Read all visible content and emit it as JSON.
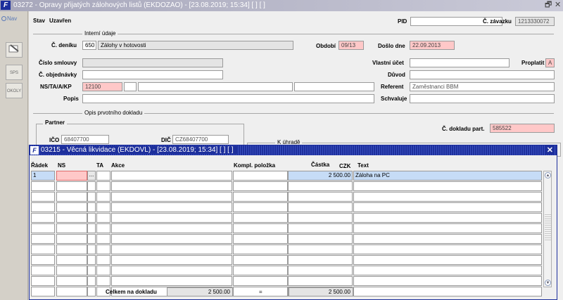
{
  "window": {
    "app_icon": "F",
    "title": "03272 - Opravy přijatých zálohových listů (EKDOZAO) - [23.08.2019; 15:34]  [ ]  [ ]",
    "restore_glyph": "ᵛ",
    "close_glyph": "✕"
  },
  "toolbar": {
    "nav_label": "Nav",
    "tools": [
      "edit-icon",
      "sps-icon",
      "okoly-icon"
    ],
    "sps_label": "SPS",
    "okoly_label": "OKOLY"
  },
  "form": {
    "stav_label": "Stav",
    "stav_value": "Uzavřen",
    "pid_label": "PID",
    "pid_value": "",
    "c_zavazku_label": "Č. závazku",
    "c_zavazku_value": "1213330072",
    "interni_udaje": "Interní údaje",
    "c_deniku_label": "Č. deníku",
    "c_deniku_value": "650",
    "denik_name": "Zálohy v hotovosti",
    "obdobi_label": "Období",
    "obdobi_value": "09/13",
    "doslo_dne_label": "Došlo dne",
    "doslo_dne_value": "22.09.2013",
    "cislo_smlouvy_label": "Číslo smlouvy",
    "vlastni_ucet_label": "Vlastní účet",
    "proplatit_label": "Proplatit",
    "proplatit_value": "A",
    "c_objednavky_label": "Č. objednávky",
    "duvod_label": "Důvod",
    "ns_label": "NS/TA/A/KP",
    "ns_value": "12100",
    "referent_label": "Referent",
    "referent_value": "Zaměstnanci BBM",
    "popis_label": "Popis",
    "schvaluje_label": "Schvaluje",
    "opis_label": "Opis prvotního dokladu",
    "partner_label": "Partner",
    "ico_label": "IČO",
    "ico_value": "68407700",
    "dic_label": "DIČ",
    "dic_value": "CZ68407700",
    "c_dokladu_part_label": "Č. dokladu part.",
    "c_dokladu_part_value": "585522",
    "k_uhrade_label": "K úhradě"
  },
  "dialog": {
    "app_icon": "F",
    "title": "03215 - Věcná likvidace (EKDOVL) - [23.08.2019; 15:34]  [ ]  [ ]",
    "close_glyph": "✕",
    "columns": {
      "radek": "Řádek",
      "ns": "NS",
      "ta": "TA",
      "akce": "Akce",
      "kompl": "Kompl. položka",
      "castka": "Částka",
      "czk": "CZK",
      "text": "Text"
    },
    "rows": [
      {
        "radek": "1",
        "ns": "",
        "ta": "",
        "akce": "",
        "kompl": "",
        "castka": "2 500.00",
        "text": "Záloha na PC"
      }
    ],
    "empty_rows": 11,
    "dots_glyph": "...",
    "celkem_label": "Celkem na dokladu",
    "celkem_value": "2 500.00",
    "equals": "=",
    "celkem_value2": "2 500.00"
  }
}
